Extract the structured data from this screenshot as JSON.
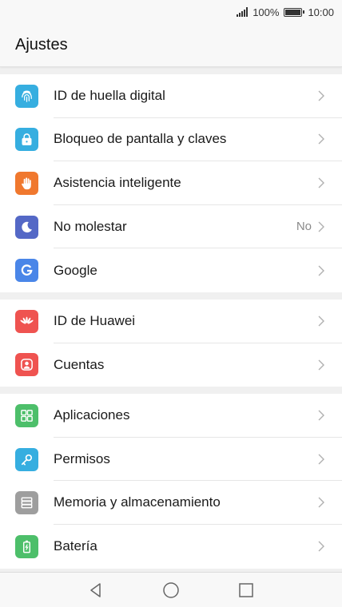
{
  "status": {
    "battery": "100%",
    "time": "10:00"
  },
  "header": {
    "title": "Ajustes"
  },
  "groups": [
    [
      {
        "label": "ID de huella digital",
        "value": "",
        "icon": "fingerprint-icon",
        "color": "#36aee0"
      },
      {
        "label": "Bloqueo de pantalla y claves",
        "value": "",
        "icon": "lock-icon",
        "color": "#36aee0"
      },
      {
        "label": "Asistencia inteligente",
        "value": "",
        "icon": "hand-icon",
        "color": "#f0782e"
      },
      {
        "label": "No molestar",
        "value": "No",
        "icon": "moon-icon",
        "color": "#5468c6"
      },
      {
        "label": "Google",
        "value": "",
        "icon": "google-icon",
        "color": "#4a86e8"
      }
    ],
    [
      {
        "label": "ID de Huawei",
        "value": "",
        "icon": "huawei-icon",
        "color": "#ef5350"
      },
      {
        "label": "Cuentas",
        "value": "",
        "icon": "account-icon",
        "color": "#ef5350"
      }
    ],
    [
      {
        "label": "Aplicaciones",
        "value": "",
        "icon": "apps-icon",
        "color": "#4dbf6a"
      },
      {
        "label": "Permisos",
        "value": "",
        "icon": "key-icon",
        "color": "#36aee0"
      },
      {
        "label": "Memoria y almacenamiento",
        "value": "",
        "icon": "storage-icon",
        "color": "#9e9e9e"
      },
      {
        "label": "Batería",
        "value": "",
        "icon": "battery-icon",
        "color": "#4dbf6a"
      }
    ]
  ]
}
